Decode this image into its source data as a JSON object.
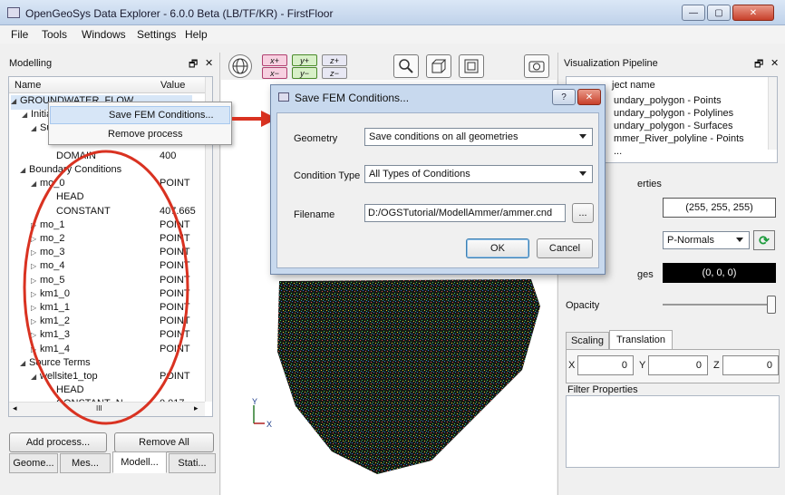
{
  "window": {
    "title": "OpenGeoSys Data Explorer - 6.0.0 Beta (LB/TF/KR) - FirstFloor",
    "minimize": "—",
    "maximize": "▢",
    "close": "✕"
  },
  "menu": [
    "File",
    "Tools",
    "Windows",
    "Settings",
    "Help"
  ],
  "left_panel": {
    "title": "Modelling",
    "float_icon": "🗗",
    "close_icon": "✕",
    "columns": [
      "Name",
      "Value"
    ],
    "rows": [
      {
        "name": "GROUNDWATER_FLOW",
        "value": "",
        "arrow": "◢"
      },
      {
        "name": "Initial C",
        "value": "",
        "arrow": "◢"
      },
      {
        "name": "Sul",
        "value": "",
        "arrow": "◢"
      },
      {
        "name": "HEAD",
        "value": "",
        "arrow": ""
      },
      {
        "name": "DOMAIN",
        "value": "400",
        "arrow": ""
      },
      {
        "name": "Boundary Conditions",
        "value": "",
        "arrow": "◢"
      },
      {
        "name": "mo_0",
        "value": "POINT",
        "arrow": "◢"
      },
      {
        "name": "HEAD",
        "value": "",
        "arrow": ""
      },
      {
        "name": "CONSTANT",
        "value": "407.665",
        "arrow": ""
      },
      {
        "name": "mo_1",
        "value": "POINT",
        "arrow": "▷"
      },
      {
        "name": "mo_2",
        "value": "POINT",
        "arrow": "▷"
      },
      {
        "name": "mo_3",
        "value": "POINT",
        "arrow": "▷"
      },
      {
        "name": "mo_4",
        "value": "POINT",
        "arrow": "▷"
      },
      {
        "name": "mo_5",
        "value": "POINT",
        "arrow": "▷"
      },
      {
        "name": "km1_0",
        "value": "POINT",
        "arrow": "▷"
      },
      {
        "name": "km1_1",
        "value": "POINT",
        "arrow": "▷"
      },
      {
        "name": "km1_2",
        "value": "POINT",
        "arrow": "▷"
      },
      {
        "name": "km1_3",
        "value": "POINT",
        "arrow": "▷"
      },
      {
        "name": "km1_4",
        "value": "POINT",
        "arrow": "▷"
      },
      {
        "name": "Source Terms",
        "value": "",
        "arrow": "◢"
      },
      {
        "name": "wellsite1_top",
        "value": "POINT",
        "arrow": "◢"
      },
      {
        "name": "HEAD",
        "value": "",
        "arrow": ""
      },
      {
        "name": "CONSTANT_N...",
        "value": "0.017",
        "arrow": ""
      }
    ],
    "hscroll_grip": "III",
    "buttons": {
      "add": "Add process...",
      "remove": "Remove All"
    },
    "tabs": [
      "Geome...",
      "Mes...",
      "Modell...",
      "Stati..."
    ]
  },
  "context_menu": {
    "items": [
      "Save FEM Conditions...",
      "Remove process"
    ]
  },
  "toolbar": {
    "axis_buttons": [
      "x+",
      "y+",
      "z+",
      "x−",
      "y−",
      "z−"
    ]
  },
  "viewport": {
    "axis_y": "Y",
    "axis_x": "X"
  },
  "dialog": {
    "title": "Save FEM Conditions...",
    "help": "?",
    "close": "✕",
    "geometry_label": "Geometry",
    "geometry_value": "Save conditions on all geometries",
    "condition_label": "Condition Type",
    "condition_value": "All Types of Conditions",
    "filename_label": "Filename",
    "filename_value": "D:/OGSTutorial/ModellAmmer/ammer.cnd",
    "browse": "...",
    "ok": "OK",
    "cancel": "Cancel"
  },
  "right_panel": {
    "title": "Visualization Pipeline",
    "float_icon": "🗗",
    "close_icon": "✕",
    "list_header": "ject name",
    "list_items": [
      "undary_polygon - Points",
      "undary_polygon - Polylines",
      "undary_polygon - Surfaces",
      "mmer_River_polyline - Points",
      "..."
    ],
    "properties_label": "erties",
    "color_value": "(255, 255, 255)",
    "normals_value": "P-Normals",
    "edges_label": "ges",
    "edges_value": "(0, 0, 0)",
    "opacity_label": "Opacity",
    "tabs": [
      "Scaling",
      "Translation"
    ],
    "x_label": "X",
    "x_value": "0",
    "y_label": "Y",
    "y_value": "0",
    "z_label": "Z",
    "z_value": "0",
    "filter_title": "Filter Properties"
  },
  "colors": {
    "accent_red": "#d93221",
    "selection": "#d7e6f7",
    "dialog_frame": "#c8d9ee"
  }
}
